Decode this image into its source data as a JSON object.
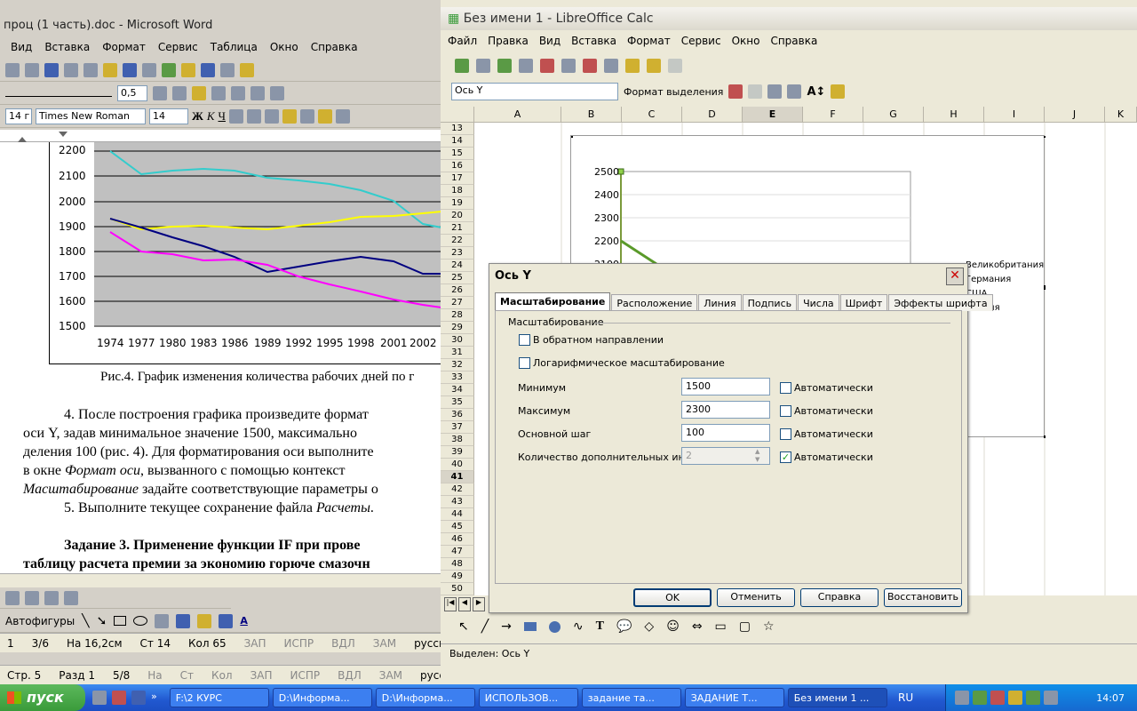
{
  "word": {
    "title": "проц (1 часть).doc - Microsoft Word",
    "menu": [
      "Вид",
      "Вставка",
      "Формат",
      "Сервис",
      "Таблица",
      "Окно",
      "Справка"
    ],
    "line_width": "0,5",
    "style_box": "14 г",
    "font_name": "Times New Roman",
    "font_size": "14",
    "chart": {
      "ylabels": [
        "2200",
        "2100",
        "2000",
        "1900",
        "1800",
        "1700",
        "1600",
        "1500"
      ],
      "xlabels": [
        "1974",
        "1977",
        "1980",
        "1983",
        "1986",
        "1989",
        "1992",
        "1995",
        "1998",
        "2001",
        "2002"
      ]
    },
    "caption": "Рис.4. График изменения количества рабочих дней по г",
    "para1": "4. После построения графика произведите формат",
    "para2": "оси Y, задав минимальное значение 1500, максимально",
    "para3": "деления 100 (рис. 4). Для форматирования оси выполните",
    "para4a": "в окне ",
    "para4b": "Формат оси",
    "para4c": ", вызванного с помощью контекст",
    "para5a": "Масштабирование",
    "para5b": " задайте соответствующие параметры о",
    "para6a": "5. Выполните текущее сохранение файла ",
    "para6b": "Расчеты",
    "para6c": ".",
    "para7": "Задание 3. Применение функции IF при прове",
    "para8": "таблицу расчета премии за экономию горюче смазочн",
    "drawing": "Автофигуры",
    "status": {
      "page": "1",
      "sec": "3/6",
      "pos": "На 16,2см",
      "line": "Ст 14",
      "col": "Кол 65",
      "rec": "ЗАП",
      "track": "ИСПР",
      "ext": "ВДЛ",
      "ovr": "ЗАМ",
      "lang": "русский (Ро"
    },
    "status2": {
      "page": "Стр. 5",
      "sec": "Разд 1",
      "pages": "5/8",
      "pos": "На",
      "line": "Ст",
      "col": "Кол",
      "rec": "ЗАП",
      "track": "ИСПР",
      "ext": "ВДЛ",
      "ovr": "ЗАМ",
      "lang": "русский (Ро"
    }
  },
  "calc": {
    "title": "Без имени 1 - LibreOffice Calc",
    "menu": [
      "Файл",
      "Правка",
      "Вид",
      "Вставка",
      "Формат",
      "Сервис",
      "Окно",
      "Справка"
    ],
    "element_select": "Ось Y",
    "format_selection": "Формат выделения",
    "columns": [
      "A",
      "B",
      "C",
      "D",
      "E",
      "F",
      "G",
      "H",
      "I",
      "J",
      "K"
    ],
    "rows": [
      "13",
      "14",
      "15",
      "16",
      "17",
      "18",
      "19",
      "20",
      "21",
      "22",
      "23",
      "24",
      "25",
      "26",
      "27",
      "28",
      "29",
      "30",
      "31",
      "32",
      "33",
      "34",
      "35",
      "36",
      "37",
      "38",
      "39",
      "40",
      "41",
      "42",
      "43",
      "44",
      "45",
      "46",
      "47",
      "48",
      "49",
      "50"
    ],
    "selected_row": "41",
    "chart_y": [
      "2500",
      "2400",
      "2300",
      "2200",
      "2100"
    ],
    "legend": [
      "Великобритания",
      "Германия",
      "США",
      "Япония"
    ],
    "status": "Выделен: Ось Y"
  },
  "dialog": {
    "title": "Ось Y",
    "tabs": [
      "Масштабирование",
      "Расположение",
      "Линия",
      "Подпись",
      "Числа",
      "Шрифт",
      "Эффекты шрифта"
    ],
    "section": "Масштабирование",
    "reverse": "В обратном направлении",
    "log": "Логарифмическое масштабирование",
    "min_label": "Минимум",
    "min_value": "1500",
    "max_label": "Максимум",
    "max_value": "2300",
    "major_label": "Основной шаг",
    "major_value": "100",
    "minor_label": "Количество дополнительных инте",
    "minor_value": "2",
    "auto": "Автоматически",
    "ok": "OK",
    "cancel": "Отменить",
    "help": "Справка",
    "reset": "Восстановить"
  },
  "taskbar": {
    "start": "пуск",
    "tasks": [
      "F:\\2 КУРС",
      "D:\\Информа...",
      "D:\\Информа...",
      "ИСПОЛЬЗОВ...",
      "задание та...",
      "ЗАДАНИЕ Т...",
      "Без имени 1 ..."
    ],
    "lang": "RU",
    "time": "14:07"
  }
}
